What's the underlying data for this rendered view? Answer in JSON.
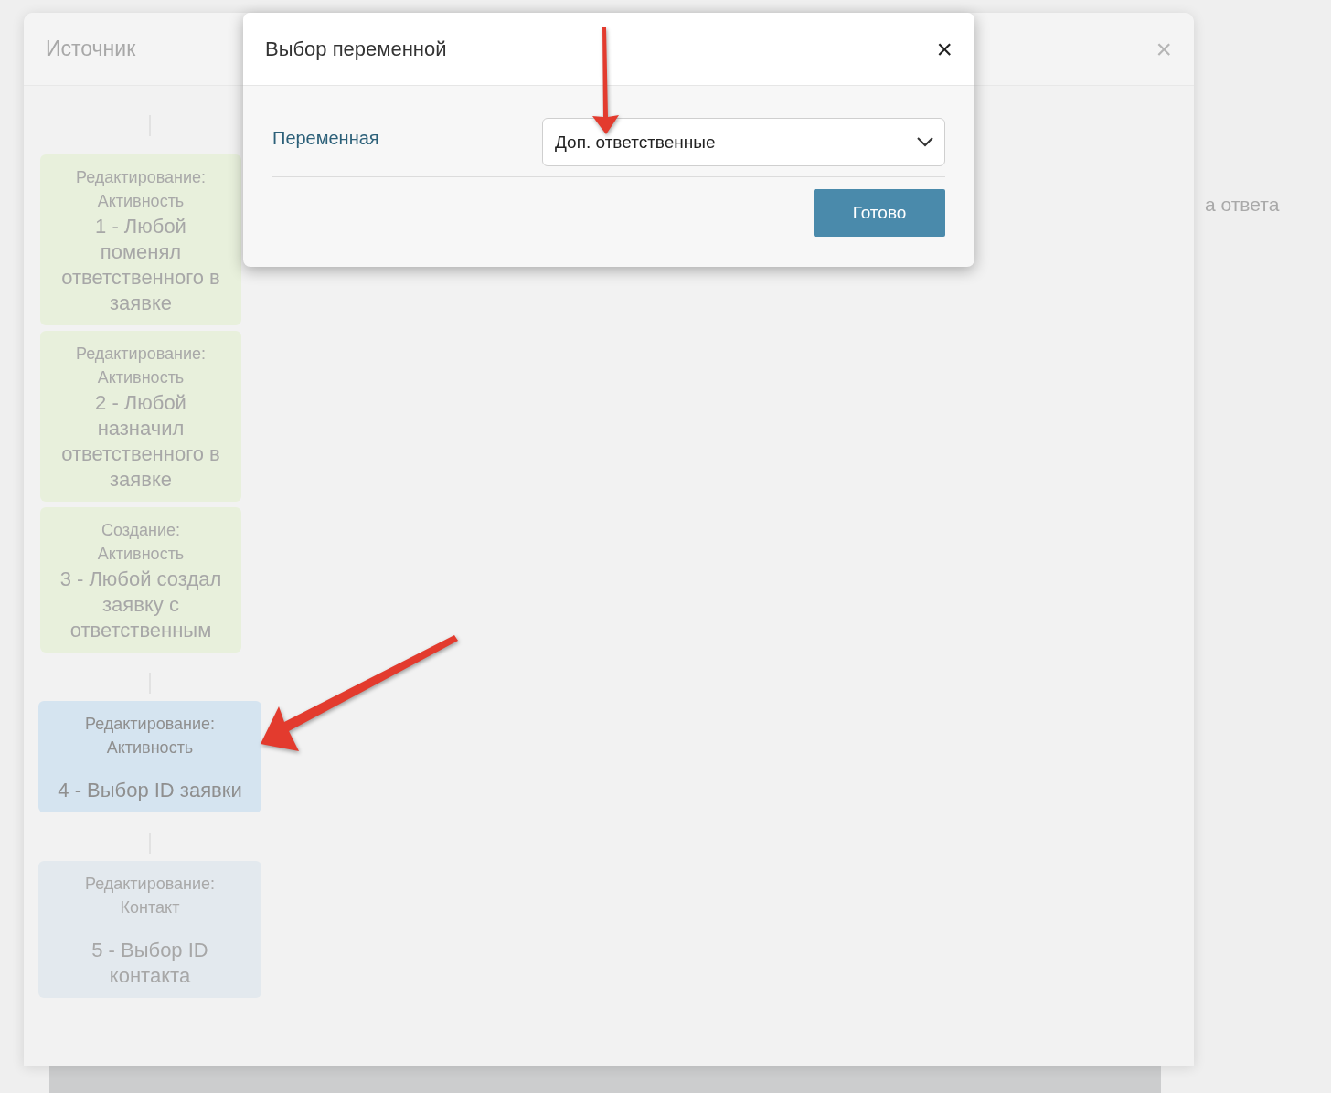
{
  "background_text": "а ответа",
  "panel": {
    "title": "Источник",
    "close": "×"
  },
  "nodes": [
    {
      "kind": "done",
      "connector_before": true,
      "action": "Редактирование:",
      "entity": "Активность",
      "title": "1 - Любой поменял ответственного в заявке"
    },
    {
      "kind": "done",
      "connector_before": false,
      "action": "Редактирование:",
      "entity": "Активность",
      "title": "2 - Любой назначил ответственного в заявке"
    },
    {
      "kind": "done",
      "connector_before": false,
      "action": "Создание:",
      "entity": "Активность",
      "title": "3 - Любой создал заявку с ответственным"
    },
    {
      "kind": "current",
      "connector_before": true,
      "action": "Редактирование:",
      "entity": "Активность",
      "title": "4 - Выбор ID заявки"
    },
    {
      "kind": "next",
      "connector_before": true,
      "action": "Редактирование:",
      "entity": "Контакт",
      "title": "5 - Выбор ID контакта"
    }
  ],
  "dialog": {
    "title": "Выбор переменной",
    "close": "×",
    "field_label": "Переменная",
    "select_value": "Доп. ответственные",
    "button": "Готово"
  }
}
